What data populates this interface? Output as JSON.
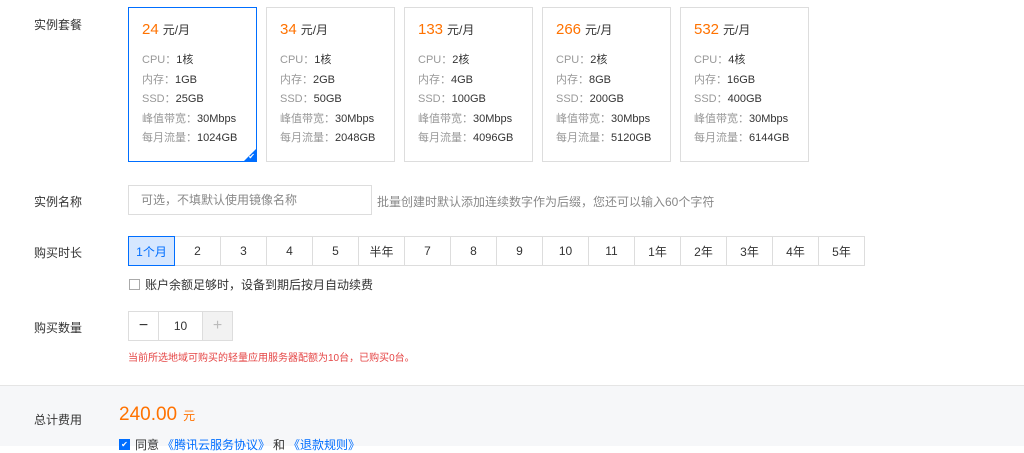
{
  "labels": {
    "plan": "实例套餐",
    "name": "实例名称",
    "duration": "购买时长",
    "quantity": "购买数量",
    "total": "总计费用"
  },
  "spec_labels": {
    "cpu": "CPU：",
    "memory": "内存：",
    "ssd": "SSD：",
    "bandwidth": "峰值带宽：",
    "traffic": "每月流量："
  },
  "price_unit": "元/月",
  "plans": [
    {
      "price": "24",
      "cpu": "1核",
      "memory": "1GB",
      "ssd": "25GB",
      "bandwidth": "30Mbps",
      "traffic": "1024GB"
    },
    {
      "price": "34",
      "cpu": "1核",
      "memory": "2GB",
      "ssd": "50GB",
      "bandwidth": "30Mbps",
      "traffic": "2048GB"
    },
    {
      "price": "133",
      "cpu": "2核",
      "memory": "4GB",
      "ssd": "100GB",
      "bandwidth": "30Mbps",
      "traffic": "4096GB"
    },
    {
      "price": "266",
      "cpu": "2核",
      "memory": "8GB",
      "ssd": "200GB",
      "bandwidth": "30Mbps",
      "traffic": "5120GB"
    },
    {
      "price": "532",
      "cpu": "4核",
      "memory": "16GB",
      "ssd": "400GB",
      "bandwidth": "30Mbps",
      "traffic": "6144GB"
    }
  ],
  "selected_plan": 0,
  "name_input": {
    "placeholder": "可选，不填默认使用镜像名称",
    "value": "",
    "hint": "批量创建时默认添加连续数字作为后缀，您还可以输入60个字符"
  },
  "durations": [
    "1个月",
    "2",
    "3",
    "4",
    "5",
    "半年",
    "7",
    "8",
    "9",
    "10",
    "11",
    "1年",
    "2年",
    "3年",
    "4年",
    "5年"
  ],
  "selected_duration": 0,
  "auto_renew": {
    "label": "账户余额足够时，设备到期后按月自动续费",
    "checked": false
  },
  "quantity": {
    "minus": "−",
    "value": "10",
    "plus": "+"
  },
  "quota_notice": "当前所选地域可购买的轻量应用服务器配额为10台，已购买0台。",
  "total": {
    "amount": "240.00",
    "currency": "元"
  },
  "agreement": {
    "prefix": "同意",
    "link1": "《腾讯云服务协议》",
    "middle": "和",
    "link2": "《退款规则》",
    "checked": true
  },
  "colors": {
    "accent": "#006eff",
    "price": "#ff7200",
    "warning": "#e54545"
  }
}
